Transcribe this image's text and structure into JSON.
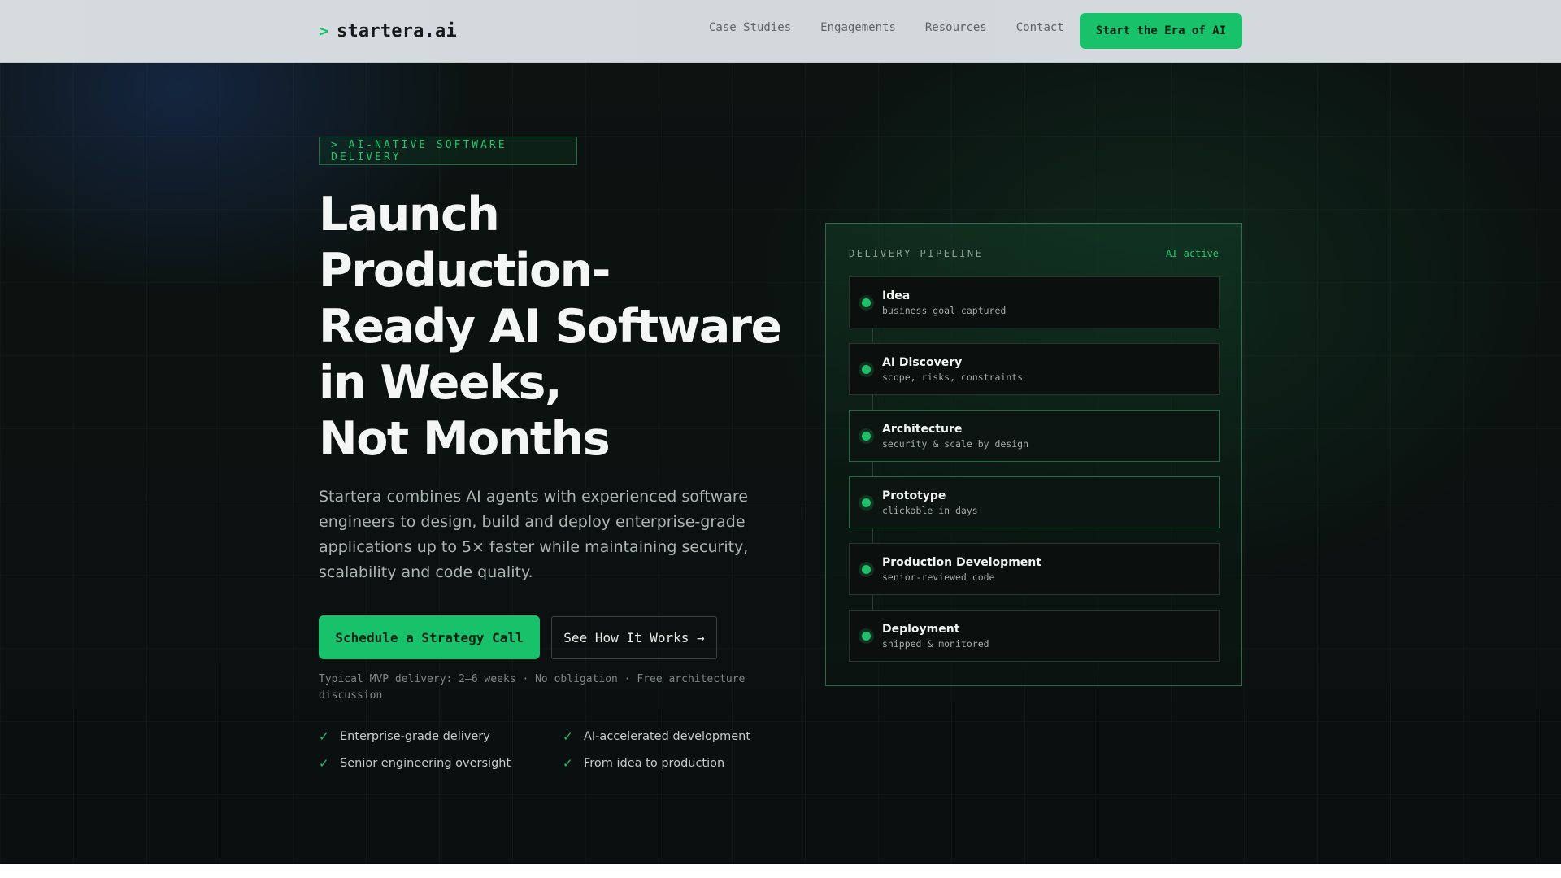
{
  "nav": {
    "logo_caret": ">",
    "logo_text": "startera.ai",
    "links": [
      "Case Studies",
      "Engagements",
      "Resources",
      "Contact"
    ],
    "cta": "Start the Era of AI"
  },
  "hero": {
    "tagline": "> AI-NATIVE SOFTWARE DELIVERY",
    "headline_lines": [
      "Launch",
      "Production-",
      "Ready AI Software",
      "in Weeks,",
      "Not Months"
    ],
    "lead": "Startera combines AI agents with experienced software engineers to design, build and deploy enterprise-grade applications up to 5× faster while maintaining security, scalability and code quality.",
    "primary_cta": "Schedule a Strategy Call",
    "secondary_cta": "See How It Works →",
    "meta": "Typical MVP delivery: 2–6 weeks · No obligation · Free architecture discussion",
    "features": [
      "Enterprise-grade delivery",
      "AI-accelerated development",
      "Senior engineering oversight",
      "From idea to production"
    ]
  },
  "pipeline": {
    "title": "DELIVERY PIPELINE",
    "status": "AI active",
    "steps": [
      {
        "name": "Idea",
        "desc": "business goal captured"
      },
      {
        "name": "AI Discovery",
        "desc": "scope, risks, constraints"
      },
      {
        "name": "Architecture",
        "desc": "security & scale by design"
      },
      {
        "name": "Prototype",
        "desc": "clickable in days"
      },
      {
        "name": "Production Development",
        "desc": "senior-reviewed code"
      },
      {
        "name": "Deployment",
        "desc": "shipped & monitored"
      }
    ]
  },
  "colors": {
    "accent": "#18c26b",
    "background": "#0b1110",
    "nav_background": "#d4dadb"
  },
  "icons": {
    "check": "check-icon",
    "step_marker": "status-dot-icon"
  }
}
